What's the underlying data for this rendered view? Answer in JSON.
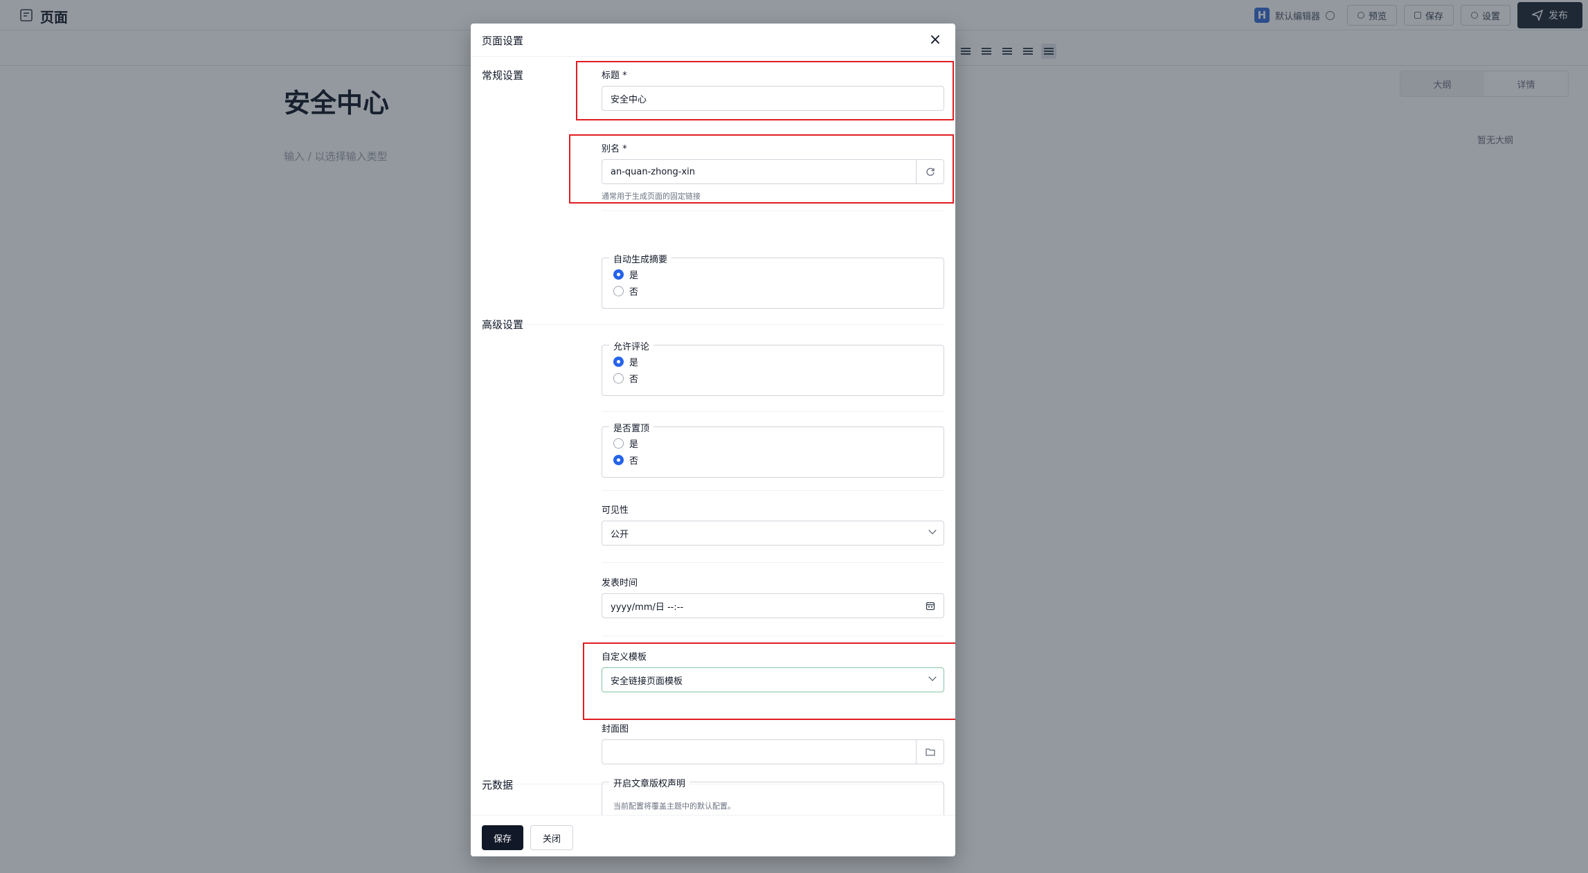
{
  "topbar": {
    "page_label": "页面",
    "editor_label": "默认编辑器",
    "editor_logo": "H",
    "preview_label": "预览",
    "save_label": "保存",
    "settings_label": "设置",
    "publish_label": "发布"
  },
  "editor": {
    "doc_title": "安全中心",
    "placeholder": "输入 / 以选择输入类型",
    "tabs": [
      "大纲",
      "详情"
    ],
    "outline_empty": "暂无大纲"
  },
  "modal": {
    "title": "页面设置",
    "close_glyph": "×",
    "sections": {
      "general": "常规设置",
      "advanced": "高级设置",
      "metadata": "元数据"
    },
    "title_field": {
      "label": "标题 *",
      "value": "安全中心"
    },
    "slug_field": {
      "label": "别名 *",
      "value": "an-quan-zhong-xin",
      "help": "通常用于生成页面的固定链接"
    },
    "auto_excerpt": {
      "legend": "自动生成摘要",
      "options": [
        "是",
        "否"
      ],
      "selected": "是"
    },
    "allow_comment": {
      "legend": "允许评论",
      "options": [
        "是",
        "否"
      ],
      "selected": "是"
    },
    "pinned": {
      "legend": "是否置顶",
      "options": [
        "是",
        "否"
      ],
      "selected": "否"
    },
    "visibility": {
      "label": "可见性",
      "value": "公开"
    },
    "publish_time": {
      "label": "发表时间",
      "placeholder": "yyyy/mm/日 --:--"
    },
    "template": {
      "label": "自定义模板",
      "value": "安全链接页面模板"
    },
    "cover": {
      "label": "封面图",
      "value": ""
    },
    "copyright": {
      "legend": "开启文章版权声明",
      "help": "当前配置将覆盖主题中的默认配置。"
    },
    "footer": {
      "save": "保存",
      "close": "关闭"
    }
  },
  "colors": {
    "primary": "#111827",
    "radio_selected": "#2563eb",
    "highlight_box": "#e11d22",
    "selected_border": "#86c6a8"
  }
}
